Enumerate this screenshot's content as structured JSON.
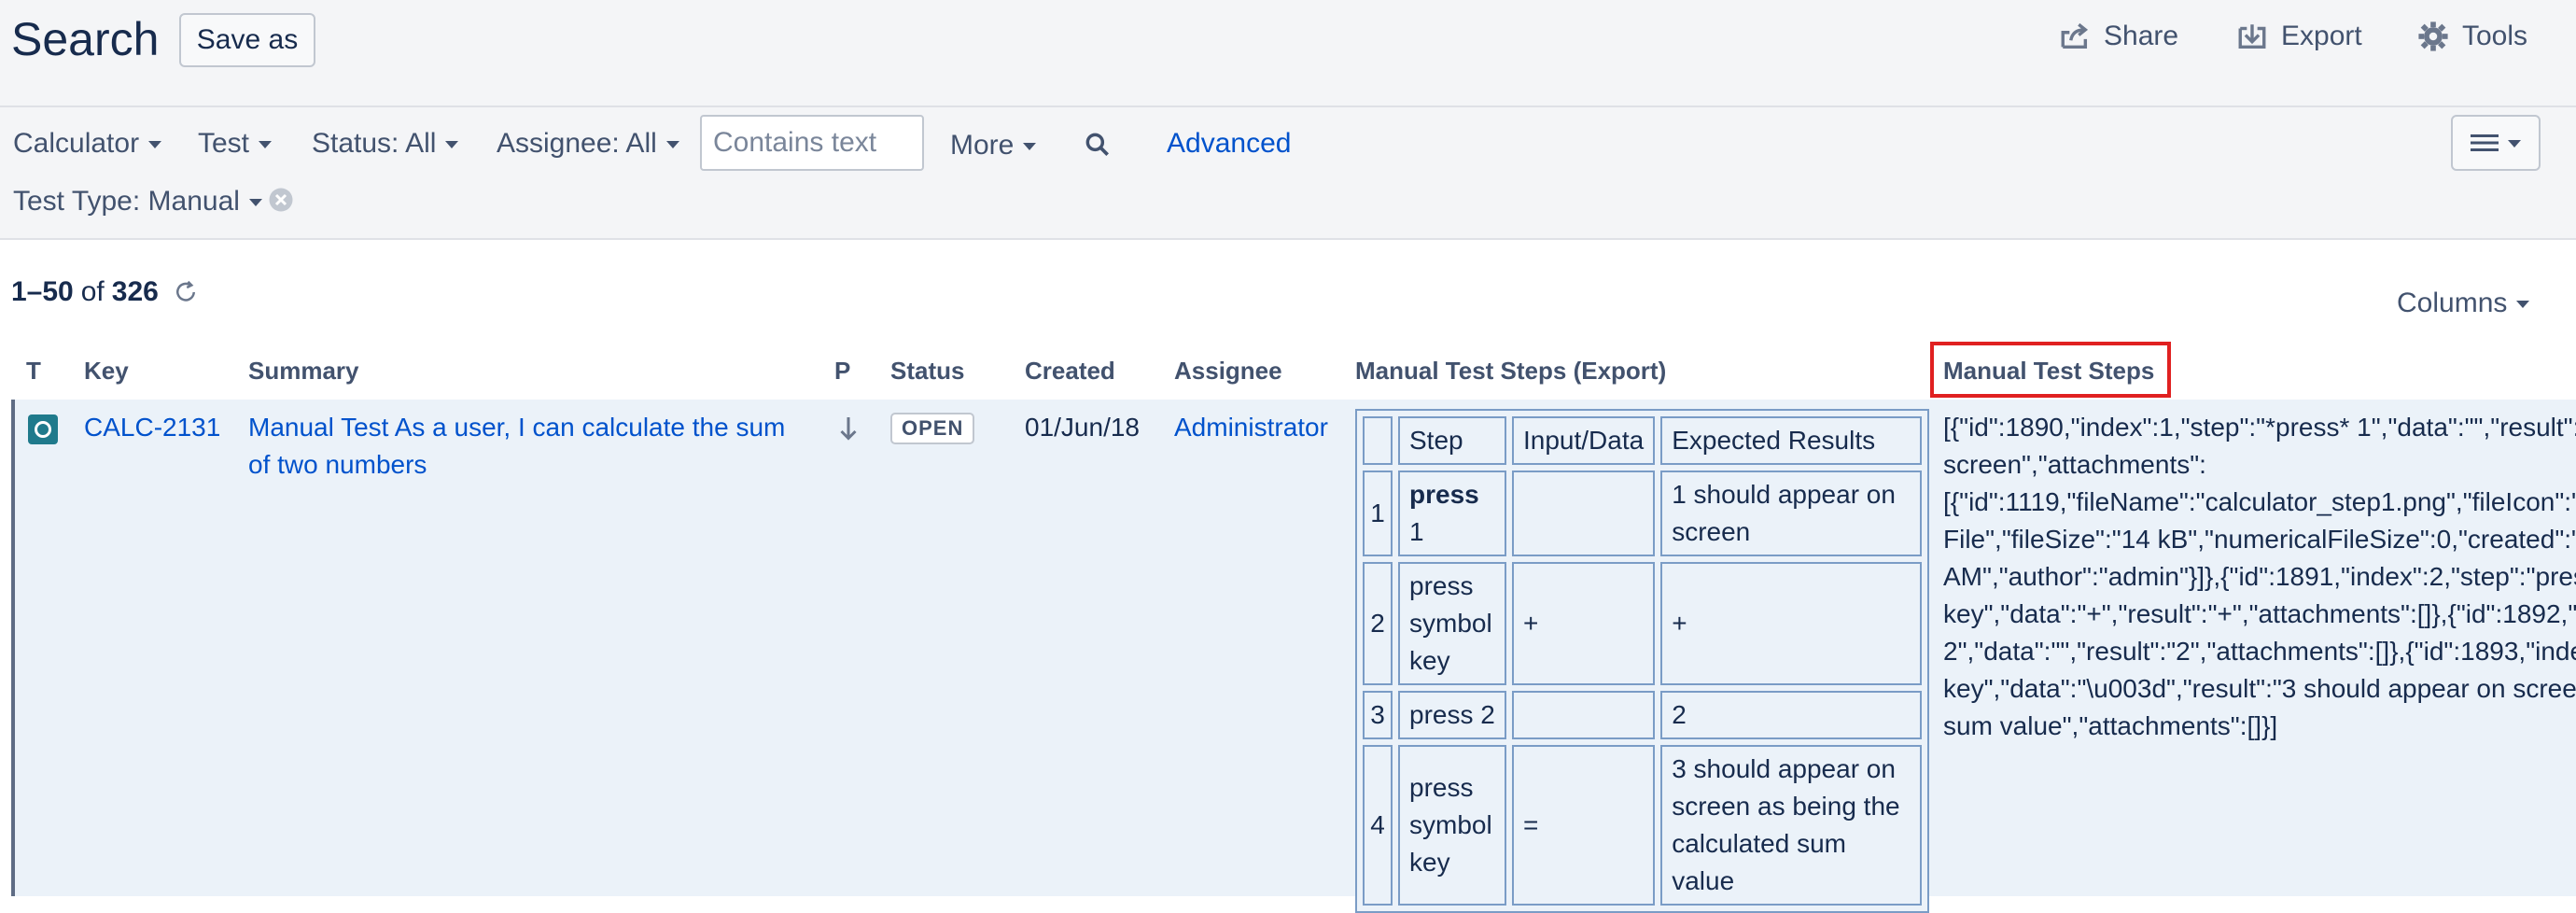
{
  "header": {
    "title": "Search",
    "save_as": "Save as",
    "share": "Share",
    "export": "Export",
    "tools": "Tools"
  },
  "filters": {
    "project": "Calculator",
    "type": "Test",
    "status": "Status: All",
    "assignee": "Assignee: All",
    "search_placeholder": "Contains text",
    "more": "More",
    "advanced": "Advanced",
    "test_type": "Test Type: Manual"
  },
  "results": {
    "range": "1–50",
    "of": "of",
    "total": "326",
    "columns": "Columns"
  },
  "table": {
    "headers": {
      "t": "T",
      "key": "Key",
      "summary": "Summary",
      "p": "P",
      "status": "Status",
      "created": "Created",
      "assignee": "Assignee",
      "steps_export": "Manual Test Steps (Export)",
      "steps": "Manual Test Steps"
    },
    "row": {
      "key": "CALC-2131",
      "summary_line1": "Manual Test As a user, I can calculate the sum",
      "summary_line2": "of two numbers",
      "status": "OPEN",
      "created": "01/Jun/18",
      "assignee": "Administrator",
      "steps_table": {
        "col_step": "Step",
        "col_data": "Input/Data",
        "col_result": "Expected Results",
        "s1": {
          "num": "1",
          "step_bold": "press",
          "step_rest": "1",
          "data": "",
          "result": "1 should appear on screen"
        },
        "s2": {
          "num": "2",
          "step": "press symbol key",
          "data": "+",
          "result": "+"
        },
        "s3": {
          "num": "3",
          "step": "press 2",
          "data": "",
          "result": "2"
        },
        "s4": {
          "num": "4",
          "step": "press symbol key",
          "data": "=",
          "result": "3 should appear on screen as being the calculated sum value"
        }
      },
      "raw_lines": [
        "[{\"id\":1890,\"index\":1,\"step\":\"*press* 1\",\"data\":\"\",\"result\":",
        "screen\",\"attachments\":",
        "[{\"id\":1119,\"fileName\":\"calculator_step1.png\",\"fileIcon\":\"",
        "File\",\"fileSize\":\"14 kB\",\"numericalFileSize\":0,\"created\":\"",
        "AM\",\"author\":\"admin\"}]},{\"id\":1891,\"index\":2,\"step\":\"pres",
        "key\",\"data\":\"+\",\"result\":\"+\",\"attachments\":[]},{\"id\":1892,\"",
        "2\",\"data\":\"\",\"result\":\"2\",\"attachments\":[]},{\"id\":1893,\"inde",
        "key\",\"data\":\"\\u003d\",\"result\":\"3 should appear on scree",
        "sum value\",\"attachments\":[]}]"
      ]
    }
  },
  "colors": {
    "link": "#0052cc",
    "highlight": "#e02020",
    "row_bg": "#ebf2f9",
    "issue_type": "#1f7a8c"
  }
}
